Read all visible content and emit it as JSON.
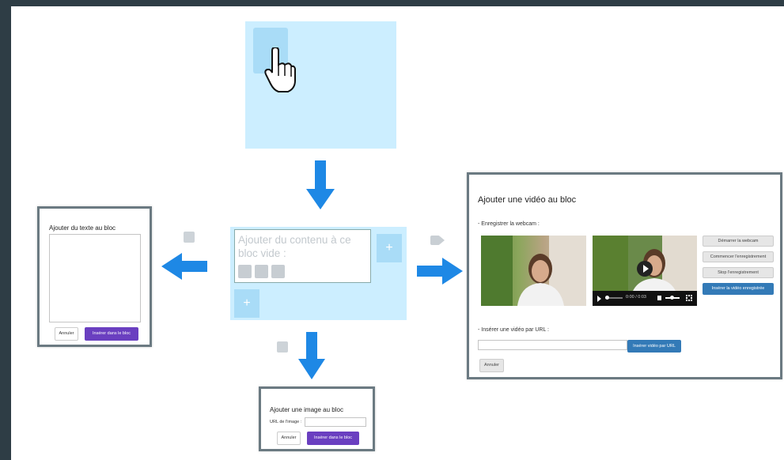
{
  "empty_block": {
    "cursor": "pointer-hand-icon"
  },
  "center_block": {
    "prompt": "Ajouter du contenu à ce bloc vide :",
    "plus_symbol": "+"
  },
  "text_panel": {
    "title": "Ajouter du texte au bloc",
    "cancel": "Annuler",
    "insert": "Insérer dans le bloc"
  },
  "image_panel": {
    "title": "Ajouter une image au bloc",
    "url_label": "URL de l'image :",
    "cancel": "Annuler",
    "insert": "Insérer dans le bloc"
  },
  "video_panel": {
    "title": "Ajouter une vidéo au bloc",
    "webcam_label": "- Enregistrer la webcam :",
    "buttons": [
      "Démarrer la webcam",
      "Commencer l'enregistrement",
      "Stop l'enregistrement",
      "Insérer la vidéo enregistrée"
    ],
    "player_time": "0:00 / 0:03",
    "url_label": "- Insérer une vidéo par URL :",
    "url_insert": "Insérer vidéo par URL",
    "cancel": "Annuler"
  },
  "colors": {
    "background": "#2e3d45",
    "block": "#cceeff",
    "arrow": "#1e88e5",
    "purple": "#6a3fc0",
    "blue": "#337ab7"
  }
}
